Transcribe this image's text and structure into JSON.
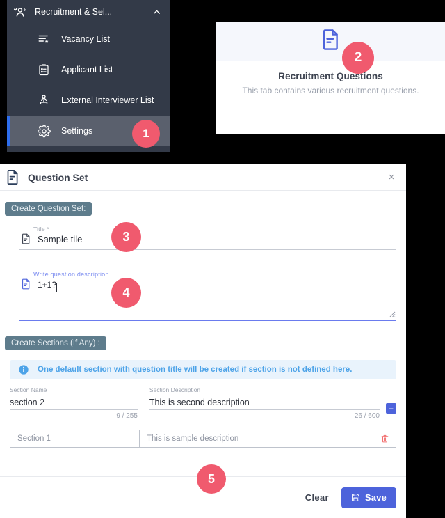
{
  "sidebar": {
    "header": {
      "icon": "users-check-icon",
      "label": "Recruitment & Sel...",
      "chevron": "chevron-up-icon"
    },
    "items": [
      {
        "icon": "list-star-icon",
        "label": "Vacancy List",
        "active": false
      },
      {
        "icon": "clipboard-list-icon",
        "label": "Applicant List",
        "active": false
      },
      {
        "icon": "org-user-icon",
        "label": "External Interviewer List",
        "active": false
      },
      {
        "icon": "gear-icon",
        "label": "Settings",
        "active": true
      }
    ]
  },
  "tab_panel": {
    "icon": "document-lines-icon",
    "title": "Recruitment Questions",
    "subtitle": "This tab contains various recruitment questions."
  },
  "dialog": {
    "icon": "document-lines-icon",
    "title": "Question Set",
    "close_label": "×",
    "section_chip": "Create Question Set:",
    "title_field": {
      "label": "Title *",
      "value": "Sample tile",
      "icon": "document-small-icon"
    },
    "description_field": {
      "label": "Write question description.",
      "value": "1+1?",
      "icon": "document-small-icon",
      "resize_handle": "resize-grip-icon"
    },
    "sections_chip": "Create Sections (If Any) :",
    "info_banner": {
      "icon": "info-circle-icon",
      "text": "One default section with question title will be created if section is not defined here."
    },
    "section_name": {
      "label": "Section Name",
      "value": "section 2",
      "counter": "9 / 255"
    },
    "section_description": {
      "label": "Section Description",
      "value": "This is second description",
      "counter": "26 / 600"
    },
    "add_button_label": "+",
    "section_rows": [
      {
        "name": "Section 1",
        "description": "This is sample description",
        "delete_icon": "trash-icon"
      }
    ],
    "footer": {
      "clear_label": "Clear",
      "save_label": "Save",
      "save_icon": "save-disk-icon"
    }
  },
  "callouts": [
    {
      "number": "1"
    },
    {
      "number": "2"
    },
    {
      "number": "3"
    },
    {
      "number": "4"
    },
    {
      "number": "5"
    }
  ],
  "colors": {
    "accent_badge": "#F05A6E",
    "primary_blue": "#4D63DB",
    "sidebar_bg": "#333A48",
    "sidebar_active": "#5A606D",
    "chip_bg": "#5E7C8C",
    "info_text": "#4DA3E8"
  }
}
